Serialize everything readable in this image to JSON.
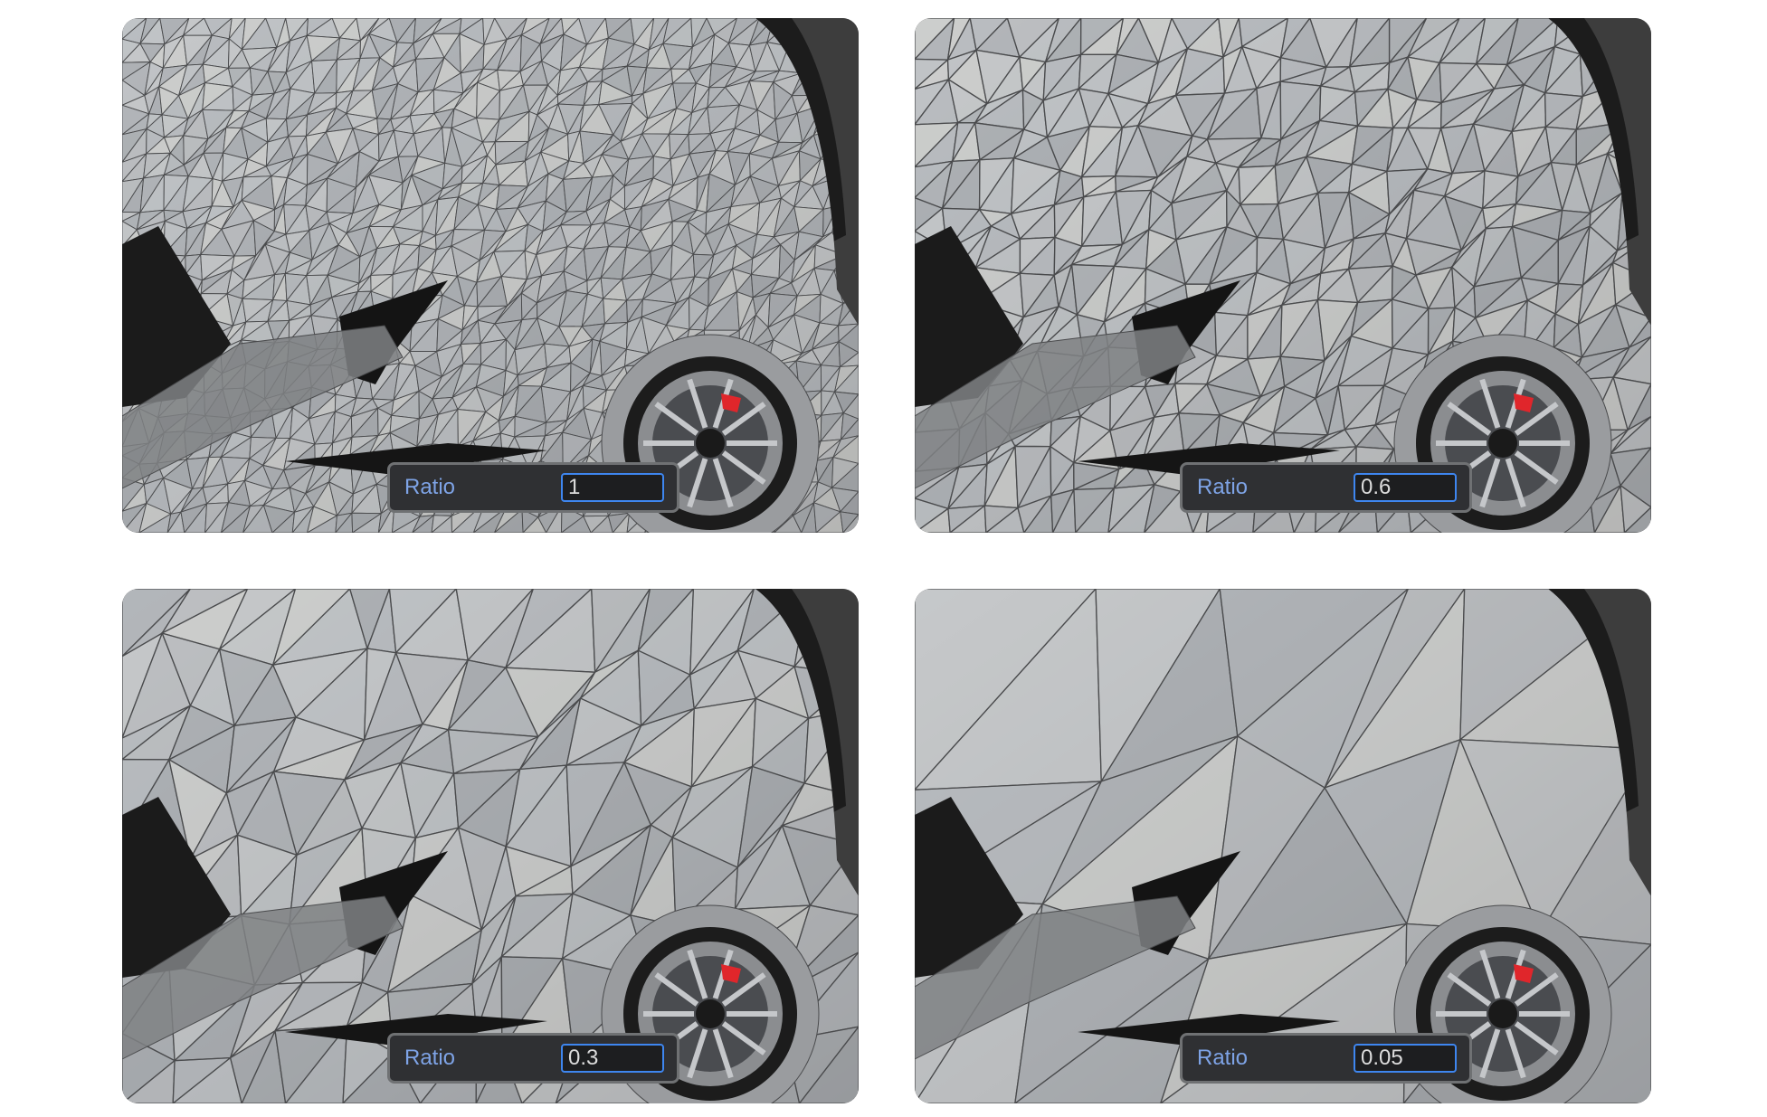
{
  "panels": [
    {
      "ratio_label": "Ratio",
      "ratio_value": "1",
      "density": 1.0
    },
    {
      "ratio_label": "Ratio",
      "ratio_value": "0.6",
      "density": 0.6
    },
    {
      "ratio_label": "Ratio",
      "ratio_value": "0.3",
      "density": 0.3
    },
    {
      "ratio_label": "Ratio",
      "ratio_value": "0.05",
      "density": 0.05
    }
  ],
  "colors": {
    "background": "#3d3d3d",
    "body": "#b9bcc0",
    "wire": "#4a4b4d",
    "shadow": "#151515",
    "label": "#7ea3e6",
    "input_border": "#3e86f0",
    "brake": "#e0262b"
  }
}
